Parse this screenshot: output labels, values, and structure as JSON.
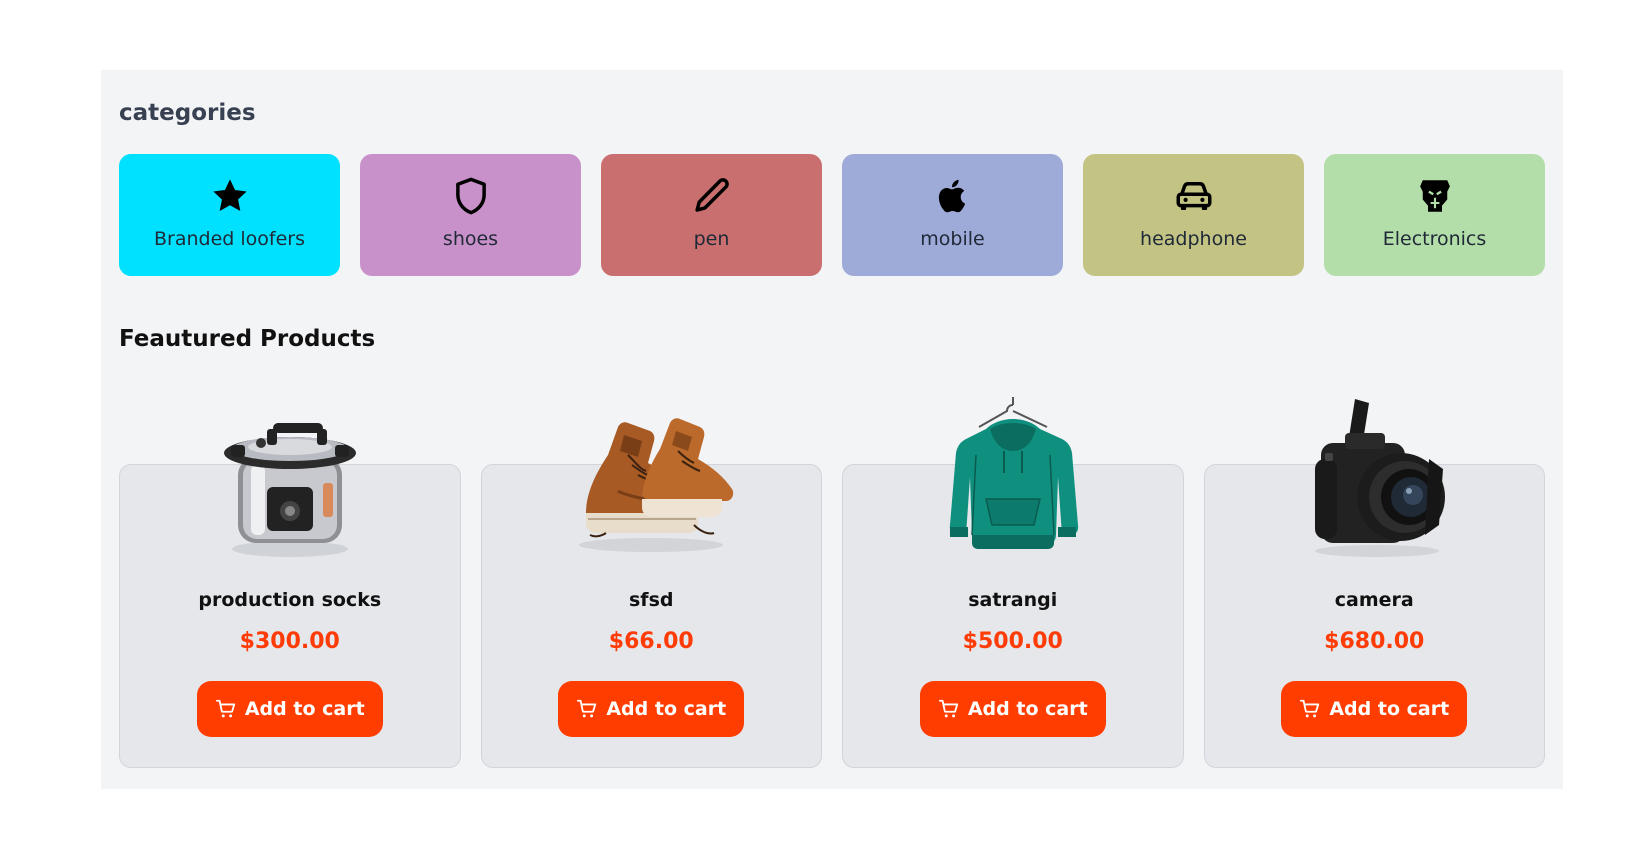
{
  "categories_section": {
    "title": "categories",
    "items": [
      {
        "label": "Branded loofers",
        "icon": "star-icon",
        "color": "#00e1ff"
      },
      {
        "label": "shoes",
        "icon": "shield-icon",
        "color": "#c991c9"
      },
      {
        "label": "pen",
        "icon": "pencil-icon",
        "color": "#c96f6f"
      },
      {
        "label": "mobile",
        "icon": "apple-icon",
        "color": "#9eaad8"
      },
      {
        "label": "headphone",
        "icon": "car-icon",
        "color": "#c3c384"
      },
      {
        "label": "Electronics",
        "icon": "transformer-icon",
        "color": "#b4dea9"
      }
    ]
  },
  "featured_section": {
    "title": "Feautured Products",
    "products": [
      {
        "name": "production socks",
        "price": "$300.00",
        "image": "pressure-cooker-image",
        "button_label": "Add to cart"
      },
      {
        "name": "sfsd",
        "price": "$66.00",
        "image": "sneakers-image",
        "button_label": "Add to cart"
      },
      {
        "name": "satrangi",
        "price": "$500.00",
        "image": "hoodie-image",
        "button_label": "Add to cart"
      },
      {
        "name": "camera",
        "price": "$680.00",
        "image": "camera-image",
        "button_label": "Add to cart"
      }
    ]
  },
  "colors": {
    "accent": "#ff3d00",
    "price": "#ff3b06",
    "panel_background": "#f3f4f6",
    "card_background": "#e5e7eb"
  }
}
